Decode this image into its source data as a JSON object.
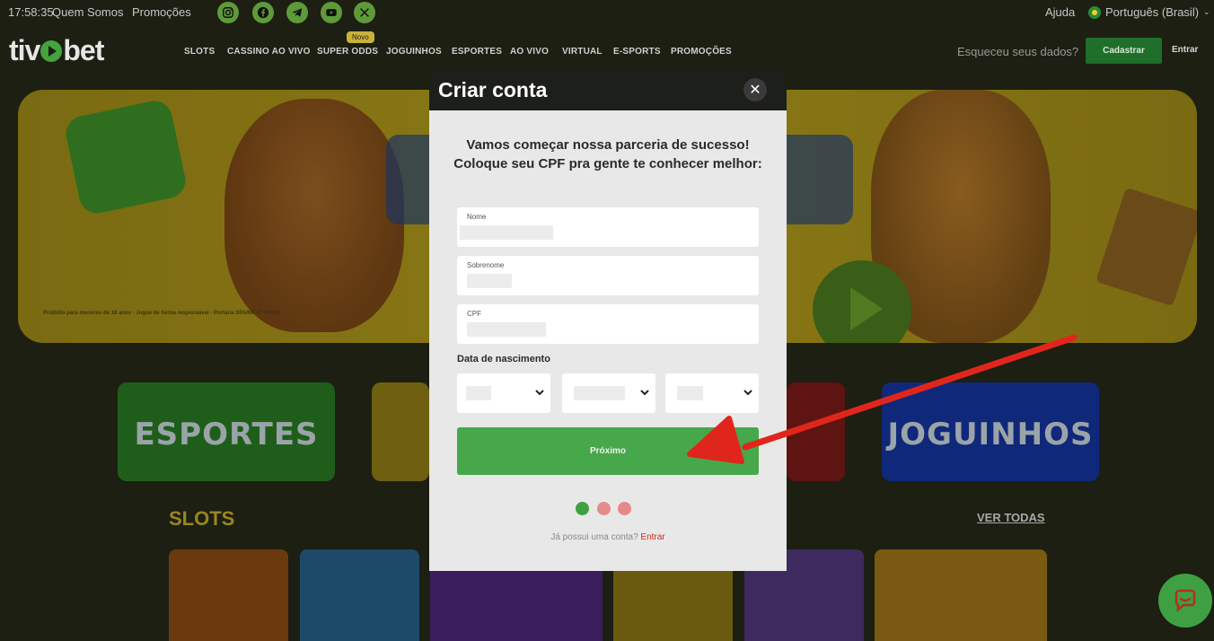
{
  "topbar": {
    "clock": "17:58:35",
    "links": [
      "Quem Somos",
      "Promoções"
    ],
    "socials": [
      "instagram-icon",
      "facebook-icon",
      "telegram-icon",
      "youtube-icon",
      "x-icon"
    ],
    "help": "Ajuda",
    "language": "Português (Brasil)"
  },
  "header": {
    "logo": {
      "part1": "tiv",
      "part2": "bet"
    },
    "nav": [
      "SLOTS",
      "CASSINO AO VIVO",
      "SUPER ODDS",
      "JOGUINHOS",
      "ESPORTES",
      "AO VIVO",
      "VIRTUAL",
      "E-SPORTS",
      "PROMOÇÕES"
    ],
    "novo_badge": "Novo",
    "forgot": "Esqueceu seus dados?",
    "register": "Cadastrar",
    "login": "Entrar"
  },
  "banner": {
    "age_notice": "Proibido para menores de 18 anos · Jogue de forma responsável · Portaria SPA/MF nº 467/25"
  },
  "tiles": {
    "esportes": "ESPORTES",
    "joguinhos": "JOGUINHOS"
  },
  "slots": {
    "title": "SLOTS",
    "see_all": "VER TODAS"
  },
  "modal": {
    "title": "Criar conta",
    "close": "✕",
    "intro": "Vamos começar nossa parceria de sucesso! Coloque seu CPF pra gente te conhecer melhor:",
    "fields": {
      "nome": {
        "label": "Nome",
        "value": ""
      },
      "sobrenome": {
        "label": "Sobrenome",
        "value": ""
      },
      "cpf": {
        "label": "CPF",
        "value": ""
      }
    },
    "dob_label": "Data de nascimento",
    "next": "Próximo",
    "steps_colors": [
      "#3fa043",
      "#e58a8a",
      "#e58a8a"
    ],
    "have_account": "Já possui uma conta?",
    "login_link": "Entrar"
  },
  "colors": {
    "accent": "#46a84a",
    "link": "#d42a1e",
    "arrow": "#e0261c"
  }
}
